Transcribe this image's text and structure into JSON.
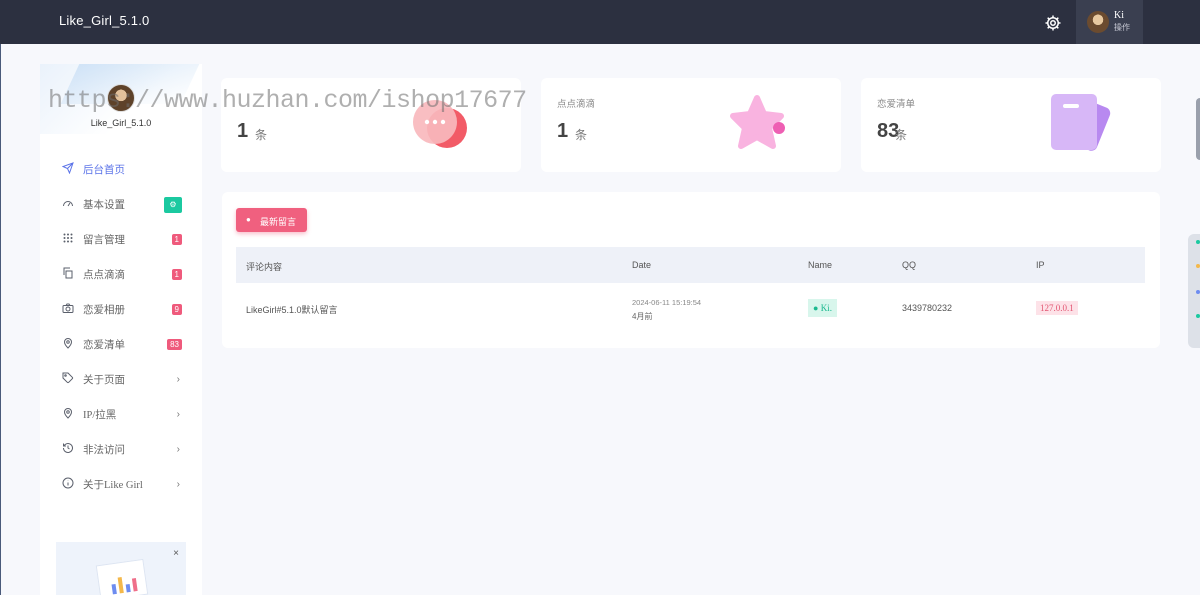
{
  "app": {
    "title": "Like_Girl_5.1.0"
  },
  "user": {
    "name": "Ki",
    "role": "操作"
  },
  "sidebar": {
    "site_name": "Like_Girl_5.1.0",
    "items": [
      {
        "label": "后台首页",
        "icon": "send-icon",
        "badge": ""
      },
      {
        "label": "基本设置",
        "icon": "gauge-icon",
        "badge": "⚙"
      },
      {
        "label": "留言管理",
        "icon": "grid-icon",
        "badge": "1"
      },
      {
        "label": "点点滴滴",
        "icon": "copy-icon",
        "badge": "1"
      },
      {
        "label": "恋爱相册",
        "icon": "camera-icon",
        "badge": "9"
      },
      {
        "label": "恋爱清单",
        "icon": "location-pin-icon",
        "badge": "83"
      },
      {
        "label": "关于页面",
        "icon": "tag-icon",
        "chevron": "›"
      },
      {
        "label": "IP/拉黑",
        "icon": "location-pin-icon",
        "chevron": "›"
      },
      {
        "label": "非法访问",
        "icon": "history-icon",
        "chevron": "›"
      },
      {
        "label": "关于Like Girl",
        "icon": "info-icon",
        "chevron": "›"
      }
    ],
    "promo": {
      "close": "×"
    }
  },
  "cards": [
    {
      "label": "",
      "value": "1",
      "unit": "条",
      "icon": "chat-bubbles-icon",
      "color": "#f47c86"
    },
    {
      "label": "点点滴滴",
      "value": "1",
      "unit": "条",
      "icon": "star-icon",
      "color": "#f59ad3"
    },
    {
      "label": "恋爱清单",
      "value": "83",
      "unit": "条",
      "icon": "ticket-icon",
      "color": "#c79df2"
    }
  ],
  "messages": {
    "button_label": "最新留言",
    "columns": [
      "评论内容",
      "Date",
      "Name",
      "QQ",
      "IP"
    ],
    "rows": [
      {
        "content": "LikeGirl#5.1.0默认留言",
        "date": "2024-06-11 15:19:54",
        "relative": "4月前",
        "name": "Ki.",
        "qq": "3439780232",
        "ip": "127.0.0.1"
      }
    ]
  },
  "watermark": "https://www.huzhan.com/ishop17677"
}
